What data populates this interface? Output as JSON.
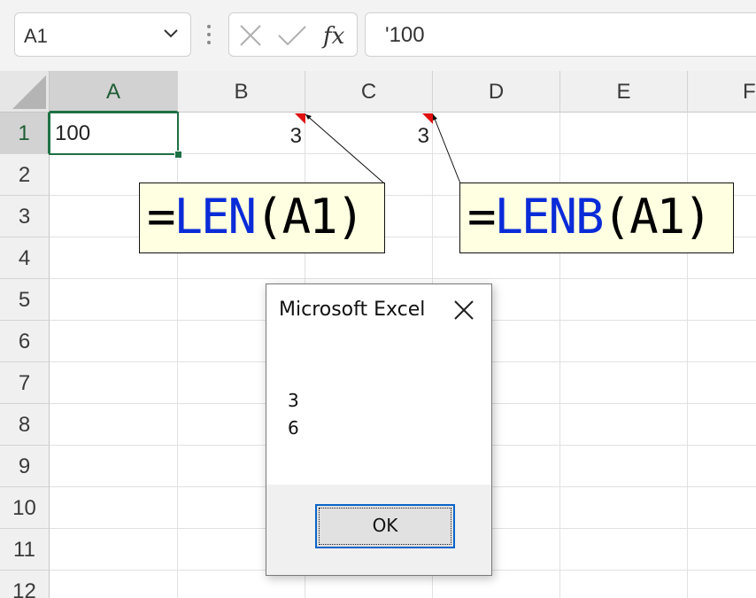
{
  "formula_bar": {
    "name_box": "A1",
    "fx_label": "fx",
    "formula_value": "'100"
  },
  "columns": [
    "A",
    "B",
    "C",
    "D",
    "E",
    "F"
  ],
  "rows": [
    "1",
    "2",
    "3",
    "4",
    "5",
    "6",
    "7",
    "8",
    "9",
    "10",
    "11",
    "12"
  ],
  "cells": {
    "A1": "100",
    "B1": "3",
    "C1": "3"
  },
  "comments": [
    {
      "eq": "=",
      "func": "LEN",
      "arg": "(A1)"
    },
    {
      "eq": "=",
      "func": "LENB",
      "arg": "(A1)"
    }
  ],
  "dialog": {
    "title": "Microsoft Excel",
    "line1": "3",
    "line2": "6",
    "ok_label": "OK"
  },
  "colors": {
    "accent": "#1e7145",
    "comment_bg": "#ffffe1",
    "function_blue": "#0a2bd8",
    "comment_indicator": "#e01010"
  }
}
